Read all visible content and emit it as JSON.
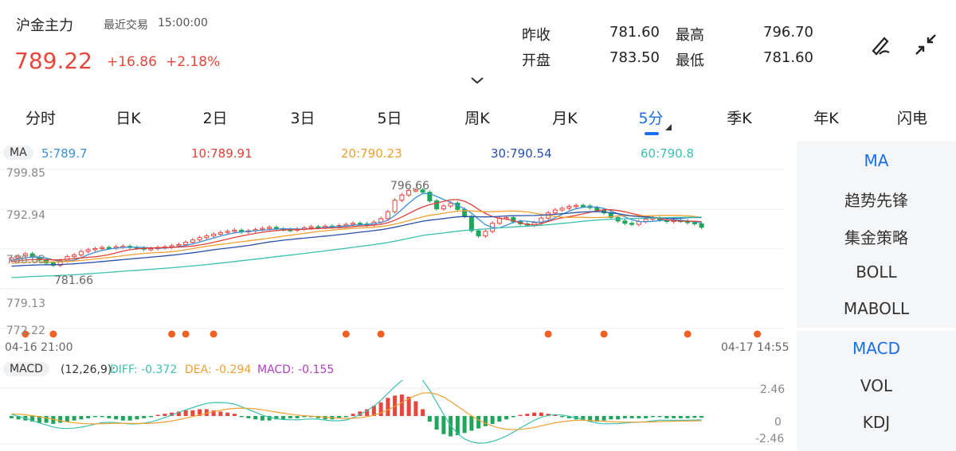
{
  "header": {
    "title": "沪金主力",
    "last_trade_label": "最近交易",
    "last_trade_time": "15:00:00",
    "price": "789.22",
    "change": "+16.86",
    "change_pct": "+2.18%",
    "prev_close_label": "昨收",
    "prev_close": "781.60",
    "high_label": "最高",
    "high": "796.70",
    "open_label": "开盘",
    "open": "783.50",
    "low_label": "最低",
    "low": "781.60"
  },
  "tabs": [
    "分时",
    "日K",
    "2日",
    "3日",
    "5日",
    "周K",
    "月K",
    "5分",
    "季K",
    "年K",
    "闪电"
  ],
  "active_tab": "5分",
  "ma_bar": {
    "tag": "MA",
    "ma5": "5:789.7",
    "ma10": "10:789.91",
    "ma20": "20:790.23",
    "ma30": "30:790.54",
    "ma60": "60:790.8"
  },
  "price_axis": [
    "799.85",
    "792.94",
    "786.03",
    "779.13",
    "772.22"
  ],
  "annotations": {
    "max": "796.66",
    "min": "781.66"
  },
  "time_axis": {
    "start": "04-16 21:00",
    "end": "04-17 14:55"
  },
  "macd_bar": {
    "tag": "MACD",
    "params": "(12,26,9):",
    "diff": "DIFF: -0.372",
    "dea": "DEA: -0.294",
    "macd": "MACD: -0.155"
  },
  "macd_axis": [
    "2.46",
    "0",
    "-2.46"
  ],
  "side_panel": {
    "main": [
      "MA",
      "趋势先锋",
      "集金策略",
      "BOLL",
      "MABOLL"
    ],
    "sub": [
      "MACD",
      "VOL",
      "KDJ"
    ]
  },
  "colors": {
    "up": "#e8453c",
    "down": "#1fa65a",
    "accent": "#1a6ee8",
    "ma5": "#3d8fd6",
    "ma10": "#e0403a",
    "ma20": "#f0a030",
    "ma30": "#2a4fa8",
    "ma60": "#3cc0b0",
    "dea": "#f0a030",
    "macd": "#b040c0",
    "dot": "#f06020"
  },
  "chart_data": {
    "type": "candlestick",
    "price_ylim": [
      772.22,
      799.85
    ],
    "closes": [
      784.5,
      784.8,
      785.2,
      784.6,
      784.1,
      783.6,
      783.2,
      784.0,
      784.7,
      785.0,
      785.6,
      785.9,
      786.1,
      786.3,
      786.2,
      786.4,
      786.5,
      786.3,
      786.2,
      786.0,
      786.1,
      786.3,
      786.4,
      786.6,
      786.8,
      787.2,
      787.6,
      788.0,
      788.3,
      788.6,
      788.9,
      789.1,
      789.3,
      789.0,
      789.2,
      789.4,
      789.6,
      789.8,
      789.5,
      789.4,
      789.3,
      789.5,
      789.7,
      789.9,
      789.8,
      790.0,
      789.9,
      790.1,
      790.3,
      790.5,
      790.4,
      790.2,
      790.7,
      791.3,
      792.5,
      794.5,
      795.4,
      796.2,
      796.3,
      795.9,
      794.4,
      793.0,
      793.5,
      794.0,
      792.9,
      791.7,
      789.2,
      788.3,
      789.1,
      790.5,
      791.4,
      791.5,
      790.8,
      790.4,
      790.2,
      790.6,
      791.4,
      792.3,
      792.8,
      793.1,
      793.4,
      793.6,
      793.5,
      793.2,
      792.8,
      792.3,
      791.5,
      790.9,
      790.5,
      790.3,
      790.8,
      791.2,
      791.4,
      791.1,
      790.8,
      791.0,
      790.9,
      790.6,
      790.4,
      789.8
    ],
    "ma5_end": 789.7,
    "ma10_end": 789.91,
    "ma20_end": 790.23,
    "ma30_end": 790.54,
    "ma60_end": 790.8,
    "macd_ylim": [
      -2.46,
      2.46
    ],
    "macd_hist": [
      -0.2,
      -0.3,
      -0.4,
      -0.5,
      -0.6,
      -0.6,
      -0.7,
      -0.6,
      -0.5,
      -0.4,
      -0.3,
      -0.2,
      -0.1,
      -0.1,
      -0.2,
      -0.3,
      -0.4,
      -0.4,
      -0.3,
      -0.2,
      -0.1,
      0.1,
      0.2,
      0.3,
      0.4,
      0.5,
      0.5,
      0.6,
      0.6,
      0.5,
      0.4,
      0.3,
      0.2,
      -0.1,
      -0.2,
      -0.3,
      -0.4,
      -0.4,
      -0.3,
      -0.3,
      -0.2,
      -0.2,
      -0.1,
      -0.1,
      -0.2,
      -0.3,
      -0.3,
      -0.2,
      -0.1,
      0.2,
      0.4,
      0.6,
      0.9,
      1.2,
      1.6,
      1.8,
      1.9,
      1.7,
      1.3,
      0.6,
      -0.5,
      -1.2,
      -1.6,
      -1.8,
      -1.7,
      -1.5,
      -1.3,
      -1.1,
      -0.9,
      -0.7,
      -0.5,
      -0.3,
      -0.1,
      0.1,
      0.2,
      0.3,
      0.3,
      0.2,
      0.1,
      -0.1,
      -0.2,
      -0.3,
      -0.4,
      -0.5,
      -0.5,
      -0.4,
      -0.3,
      -0.3,
      -0.2,
      -0.2,
      -0.2,
      -0.2,
      -0.1,
      -0.1,
      -0.2,
      -0.2,
      -0.2,
      -0.2,
      -0.16,
      -0.155
    ],
    "dot_positions": [
      2,
      6,
      23,
      25,
      29,
      48,
      53,
      77,
      85,
      97,
      107
    ]
  }
}
